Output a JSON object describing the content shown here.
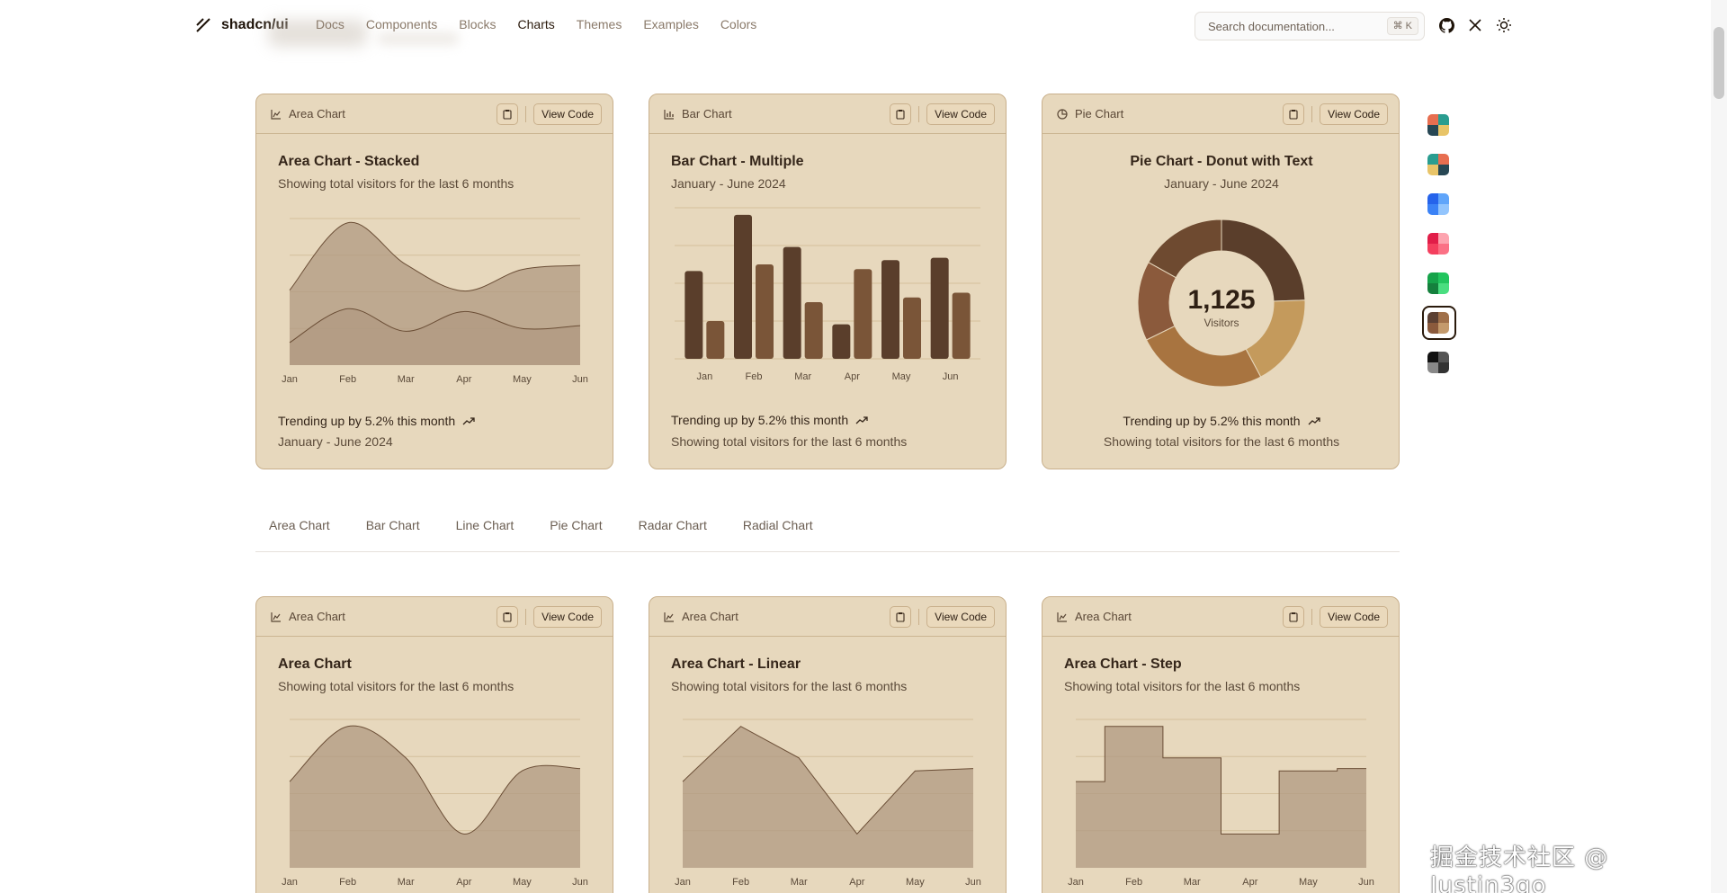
{
  "header": {
    "logo_text": "shadcn/ui",
    "nav": [
      "Docs",
      "Components",
      "Blocks",
      "Charts",
      "Themes",
      "Examples",
      "Colors"
    ],
    "active_nav": "Charts",
    "search_placeholder": "Search documentation...",
    "search_shortcut": "⌘ K",
    "icons": [
      "github-icon",
      "x-icon",
      "sun-icon"
    ]
  },
  "top_cards": [
    {
      "type_label": "Area Chart",
      "view_code": "View Code",
      "title": "Area Chart - Stacked",
      "subtitle": "Showing total visitors for the last 6 months",
      "footer_trend": "Trending up by 5.2% this month",
      "footer_note": "January - June 2024"
    },
    {
      "type_label": "Bar Chart",
      "view_code": "View Code",
      "title": "Bar Chart - Multiple",
      "subtitle": "January - June 2024",
      "footer_trend": "Trending up by 5.2% this month",
      "footer_note": "Showing total visitors for the last 6 months"
    },
    {
      "type_label": "Pie Chart",
      "view_code": "View Code",
      "title": "Pie Chart - Donut with Text",
      "subtitle": "January - June 2024",
      "center_value": "1,125",
      "center_label": "Visitors",
      "footer_trend": "Trending up by 5.2% this month",
      "footer_note": "Showing total visitors for the last 6 months"
    }
  ],
  "tabs": [
    "Area Chart",
    "Bar Chart",
    "Line Chart",
    "Pie Chart",
    "Radar Chart",
    "Radial Chart"
  ],
  "bottom_cards": [
    {
      "type_label": "Area Chart",
      "view_code": "View Code",
      "title": "Area Chart",
      "subtitle": "Showing total visitors for the last 6 months"
    },
    {
      "type_label": "Area Chart",
      "view_code": "View Code",
      "title": "Area Chart - Linear",
      "subtitle": "Showing total visitors for the last 6 months"
    },
    {
      "type_label": "Area Chart",
      "view_code": "View Code",
      "title": "Area Chart - Step",
      "subtitle": "Showing total visitors for the last 6 months"
    }
  ],
  "theme_swatches": [
    {
      "name": "default",
      "colors": [
        "#e76e50",
        "#2a9d90",
        "#274754",
        "#e8c468"
      ]
    },
    {
      "name": "palette",
      "colors": [
        "#2a9d90",
        "#e76e50",
        "#e8c468",
        "#274754"
      ]
    },
    {
      "name": "blue",
      "colors": [
        "#2563eb",
        "#60a5fa",
        "#3b82f6",
        "#93c5fd"
      ]
    },
    {
      "name": "rose",
      "colors": [
        "#e11d48",
        "#fda4af",
        "#f43f5e",
        "#fb7185"
      ]
    },
    {
      "name": "green",
      "colors": [
        "#16a34a",
        "#22c55e",
        "#15803d",
        "#4ade80"
      ]
    },
    {
      "name": "brown",
      "colors": [
        "#5c4033",
        "#a0704a",
        "#8b5a3c",
        "#c49a6c"
      ]
    },
    {
      "name": "neutral",
      "colors": [
        "#111111",
        "#555555",
        "#888888",
        "#333333"
      ]
    }
  ],
  "selected_theme": "brown",
  "colors": {
    "card_bg": "#e7d8bd",
    "border": "#c9b08c",
    "chart_fill": "#b09a82",
    "bar_dark": "#5a3e2b",
    "bar_light": "#7a5538"
  },
  "watermark": "掘金技术社区 @ Justin3go",
  "chart_data": [
    {
      "type": "area",
      "x": [
        "Jan",
        "Feb",
        "Mar",
        "Apr",
        "May",
        "Jun"
      ],
      "series": [
        {
          "values": [
            80,
            200,
            120,
            190,
            130,
            140
          ]
        },
        {
          "values": [
            186,
            305,
            237,
            73,
            209,
            214
          ]
        }
      ],
      "stacked": true
    },
    {
      "type": "bar",
      "categories": [
        "Jan",
        "Feb",
        "Mar",
        "Apr",
        "May",
        "Jun"
      ],
      "series": [
        {
          "values": [
            186,
            305,
            237,
            73,
            209,
            214
          ]
        },
        {
          "values": [
            80,
            200,
            120,
            190,
            130,
            140
          ]
        }
      ]
    },
    {
      "type": "pie",
      "values": [
        275,
        200,
        287,
        173,
        190
      ],
      "colors": [
        "#5a3e2b",
        "#c49a5c",
        "#a87440",
        "#8b5a3c",
        "#6e4a30"
      ],
      "center_value": "1,125",
      "center_label": "Visitors"
    },
    {
      "type": "area",
      "x": [
        "Jan",
        "Feb",
        "Mar",
        "Apr",
        "May",
        "Jun"
      ],
      "series": [
        {
          "values": [
            186,
            305,
            237,
            73,
            209,
            214
          ]
        }
      ],
      "curve": "natural"
    },
    {
      "type": "area",
      "x": [
        "Jan",
        "Feb",
        "Mar",
        "Apr",
        "May",
        "Jun"
      ],
      "series": [
        {
          "values": [
            186,
            305,
            237,
            73,
            209,
            214
          ]
        }
      ],
      "curve": "linear"
    },
    {
      "type": "area",
      "x": [
        "Jan",
        "Feb",
        "Mar",
        "Apr",
        "May",
        "Jun"
      ],
      "series": [
        {
          "values": [
            186,
            305,
            237,
            73,
            209,
            214
          ]
        }
      ],
      "curve": "step"
    }
  ]
}
